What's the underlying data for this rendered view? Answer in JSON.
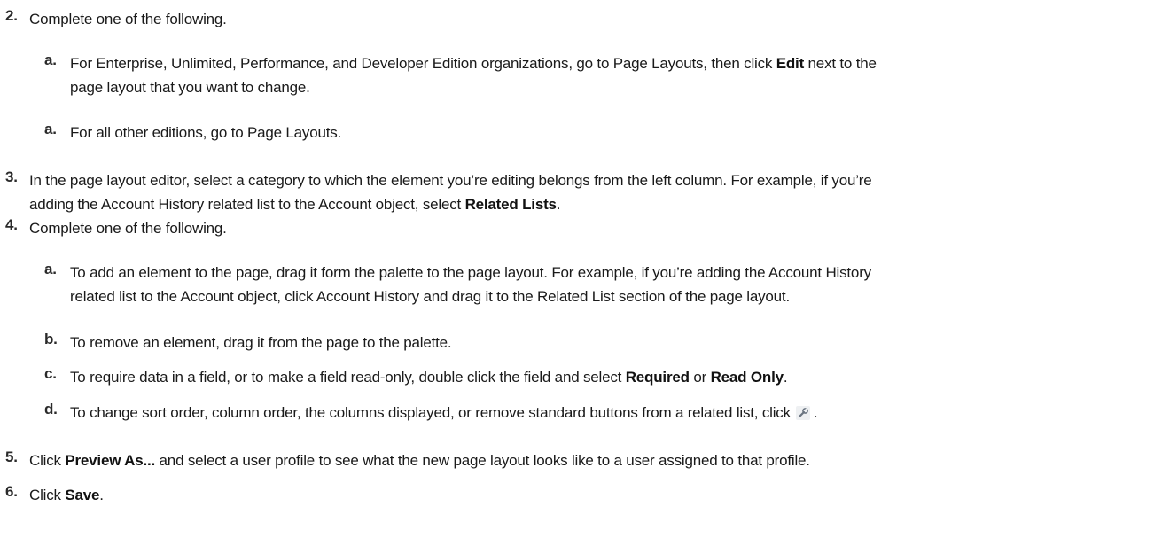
{
  "steps": [
    {
      "num": "2.",
      "pre": "Complete one of the following."
    },
    {
      "num": "a.",
      "pre": "For Enterprise, Unlimited, Performance, and Developer Edition organizations, go to Page Layouts, then click ",
      "b1": "Edit",
      "mid": " next to the",
      "line2": "page layout that you want to change."
    },
    {
      "num": "a.",
      "pre": "For all other editions, go to Page Layouts."
    },
    {
      "num": "3.",
      "pre": "In the page layout editor, select a category to which the element you’re editing belongs from the left column. For example, if you’re",
      "line2": "adding the Account History related list to the Account object, select ",
      "b1": "Related Lists",
      "post": "."
    },
    {
      "num": "4.",
      "pre": "Complete one of the following."
    },
    {
      "num": "a.",
      "pre": "To add an element to the page, drag it form the palette to the page layout. For example, if you’re adding the Account History",
      "line2": "related list to the Account object, click Account History and drag it to the Related List section of the page layout."
    },
    {
      "num": "b.",
      "pre": "To remove an element, drag it from the page to the palette."
    },
    {
      "num": "c.",
      "pre": "To require data in a field, or to make a field read-only, double click the field and select ",
      "b1": "Required",
      "mid": " or ",
      "b2": "Read Only",
      "post": "."
    },
    {
      "num": "d.",
      "pre": "To change sort order, column order, the columns displayed, or remove standard buttons from a related list, click",
      "post": "."
    },
    {
      "num": "5.",
      "pre": "Click ",
      "b1": "Preview As...",
      "post": " and select a user profile to see what the new page layout looks like to a user assigned to that profile."
    },
    {
      "num": "6.",
      "pre": "Click ",
      "b1": "Save",
      "post": "."
    }
  ],
  "icons": {
    "wrench": "wrench-icon"
  }
}
